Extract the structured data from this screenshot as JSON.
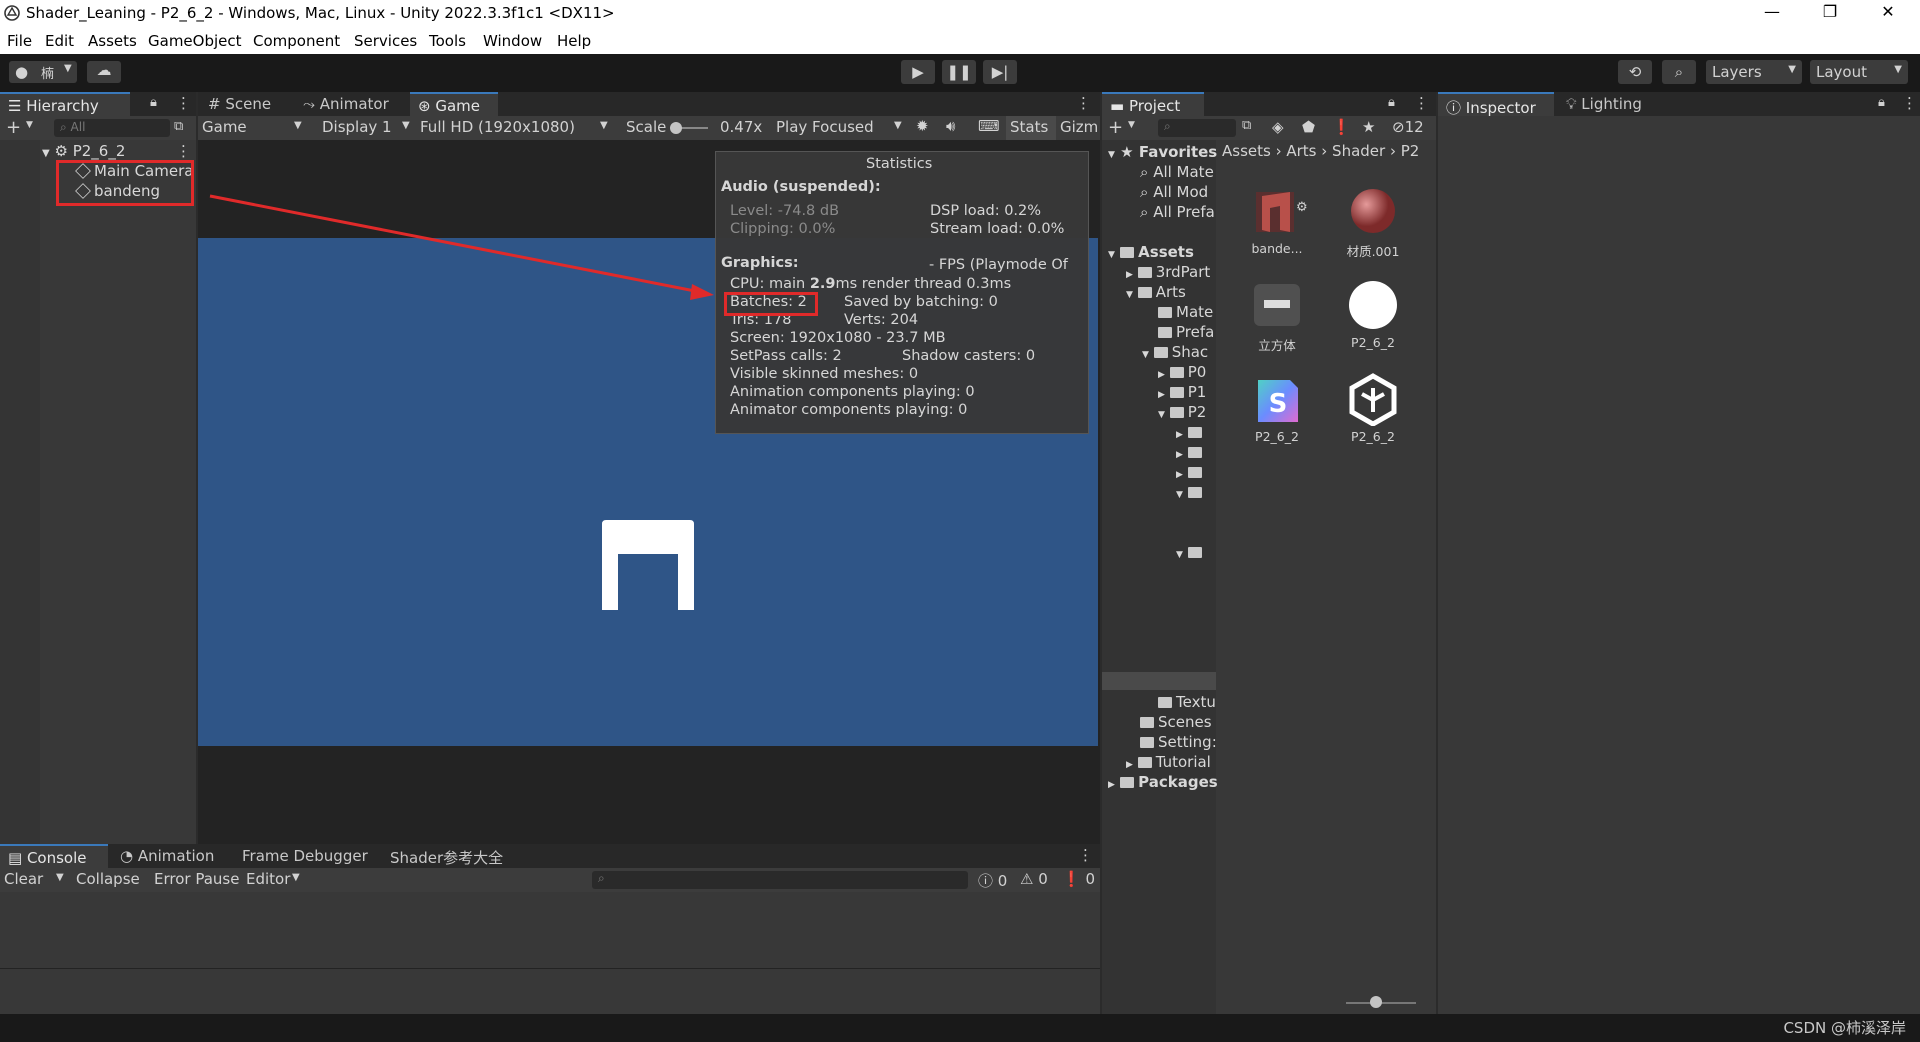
{
  "window": {
    "title": "Shader_Leaning - P2_6_2 - Windows, Mac, Linux - Unity 2022.3.3f1c1 <DX11>",
    "minimize": "—",
    "restore": "❐",
    "close": "✕"
  },
  "menu": [
    "File",
    "Edit",
    "Assets",
    "GameObject",
    "Component",
    "Services",
    "Tools",
    "Window",
    "Help"
  ],
  "toolbar": {
    "account_label": "楠",
    "layers": "Layers",
    "layout": "Layout"
  },
  "hierarchy": {
    "tab": "Hierarchy",
    "search_placeholder": "All",
    "scene": "P2_6_2",
    "items": [
      "Main Camera",
      "bandeng"
    ]
  },
  "center_tabs": [
    "Scene",
    "Animator",
    "Game"
  ],
  "game_toolbar": {
    "view": "Game",
    "display": "Display 1",
    "resolution": "Full HD (1920x1080)",
    "scale_label": "Scale",
    "scale_value": "0.47x",
    "play_mode": "Play Focused",
    "stats": "Stats",
    "gizmos": "Gizm"
  },
  "stats": {
    "title": "Statistics",
    "audio_header": "Audio (suspended):",
    "level": "Level: -74.8 dB",
    "clipping": "Clipping: 0.0%",
    "dsp": "DSP load: 0.2%",
    "stream": "Stream load: 0.0%",
    "graphics_header": "Graphics:",
    "fps": "- FPS (Playmode Of",
    "cpu_prefix": "CPU: main ",
    "cpu_main": "2.9",
    "cpu_suffix": "ms  render thread 0.3ms",
    "batches": "Batches: 2",
    "saved": "Saved by batching: 0",
    "tris": "Tris: 178",
    "verts": "Verts: 204",
    "screen": "Screen: 1920x1080 - 23.7 MB",
    "setpass": "SetPass calls: 2",
    "shadow": "Shadow casters: 0",
    "skinned": "Visible skinned meshes: 0",
    "anim": "Animation components playing: 0",
    "animator": "Animator components playing: 0"
  },
  "bottom": {
    "tabs": [
      "Console",
      "Animation",
      "Frame Debugger",
      "Shader参考大全"
    ],
    "clear": "Clear",
    "collapse": "Collapse",
    "error_pause": "Error Pause",
    "editor": "Editor",
    "count_info": "0",
    "count_warn": "0",
    "count_err": "0"
  },
  "project": {
    "tab": "Project",
    "count": "12",
    "breadcrumb": [
      "Assets",
      "Arts",
      "Shader",
      "P2"
    ],
    "favorites": "Favorites",
    "fav_items": [
      "All Mate",
      "All Mod",
      "All Prefa"
    ],
    "assets": "Assets",
    "tree": [
      "3rdPart",
      "Arts",
      "Mate",
      "Prefa",
      "Shac",
      "P0",
      "P1",
      "P2",
      "Textu",
      "Scenes",
      "Setting:",
      "Tutorial"
    ],
    "packages": "Packages",
    "grid": [
      "bande...",
      "材质.001",
      "立方体",
      "P2_6_2",
      "P2_6_2",
      "P2_6_2"
    ]
  },
  "right_tabs": [
    "Inspector",
    "Lighting"
  ],
  "watermark": "CSDN @柿溪泽岸",
  "colors": {
    "accent": "#3a79bb",
    "game_bg": "#2f5587",
    "annotation": "#e02a2a"
  }
}
